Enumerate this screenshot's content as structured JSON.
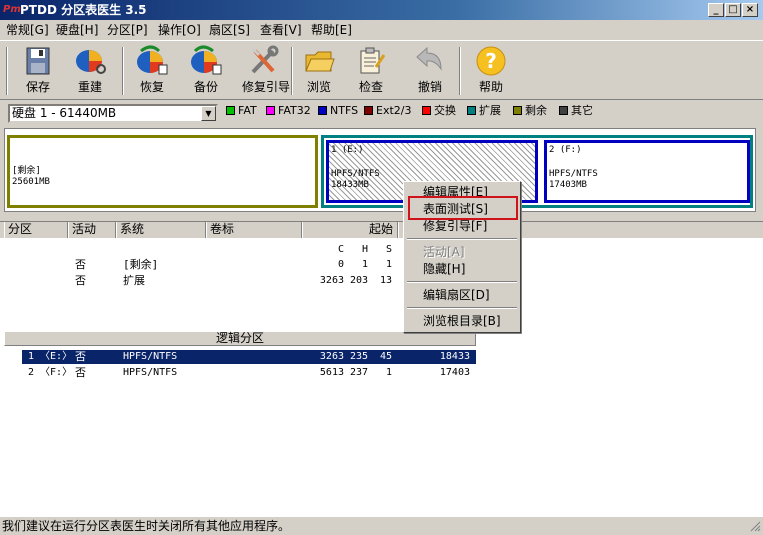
{
  "window": {
    "title": "PTDD 分区表医生 3.5",
    "minimize": "_",
    "maximize": "□",
    "close": "×"
  },
  "menu": [
    "常规[G]",
    "硬盘[H]",
    "分区[P]",
    "操作[O]",
    "扇区[S]",
    "查看[V]",
    "帮助[E]"
  ],
  "toolbar": {
    "save": "保存",
    "rebuild": "重建",
    "restore": "恢复",
    "backup": "备份",
    "repair_boot": "修复引导",
    "browse": "浏览",
    "check": "检查",
    "undo": "撤销",
    "help": "帮助"
  },
  "disk_select": {
    "value": "硬盘 1 - 61440MB"
  },
  "legend": [
    {
      "label": "FAT",
      "color": "#00c000"
    },
    {
      "label": "FAT32",
      "color": "#ff00ff"
    },
    {
      "label": "NTFS",
      "color": "#0000c0"
    },
    {
      "label": "Ext2/3",
      "color": "#800000"
    },
    {
      "label": "交换",
      "color": "#ff0000"
    },
    {
      "label": "扩展",
      "color": "#008080"
    },
    {
      "label": "剩余",
      "color": "#808000"
    },
    {
      "label": "其它",
      "color": "#404040"
    }
  ],
  "map": {
    "free": {
      "line1": "[剩余]",
      "line2": "25601MB"
    },
    "e": {
      "line1": "1 (E:)",
      "line2": "HPFS/NTFS",
      "line3": "18433MB"
    },
    "f": {
      "line1": "2 (F:)",
      "line2": "HPFS/NTFS",
      "line3": "17403MB"
    }
  },
  "list_headers": {
    "partition": "分区",
    "active": "活动",
    "system": "系统",
    "label": "卷标",
    "start": "起始"
  },
  "chs_headers": {
    "c": "C",
    "h": "H",
    "s": "S"
  },
  "primary_rows": [
    {
      "active": "否",
      "system": "[剩余]",
      "c": "0",
      "h": "1",
      "s": "1"
    },
    {
      "active": "否",
      "system": "扩展",
      "c": "3263",
      "h": "203",
      "s": "13"
    }
  ],
  "logical_header": "逻辑分区",
  "logical_rows": [
    {
      "partition": "1 〈E:〉",
      "active": "否",
      "system": "HPFS/NTFS",
      "c": "3263",
      "h": "235",
      "s": "45",
      "size": "18433"
    },
    {
      "partition": "2 〈F:〉",
      "active": "否",
      "system": "HPFS/NTFS",
      "c": "5613",
      "h": "237",
      "s": "1",
      "size": "17403"
    }
  ],
  "context_menu": {
    "edit_props": "编辑属性[E]",
    "surface_test": "表面测试[S]",
    "repair_boot": "修复引导[F]",
    "activate": "活动[A]",
    "hide": "隐藏[H]",
    "edit_sector": "编辑扇区[D]",
    "browse_root": "浏览根目录[B]"
  },
  "status": "我们建议在运行分区表医生时关闭所有其他应用程序。"
}
